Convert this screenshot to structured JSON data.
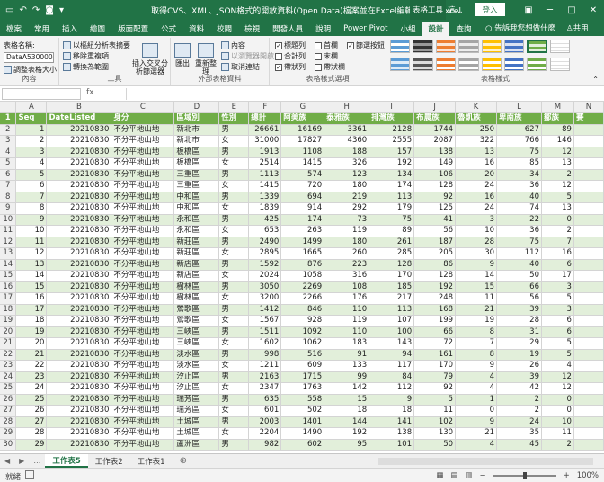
{
  "titlebar": {
    "title": "取得CVS、XML、JSON格式的開放資料(Open Data)檔案並在Excel編輯.xlsx - Excel",
    "context_tab": "表格工具",
    "search_label": "這...",
    "login": "登入"
  },
  "tabs": [
    "檔案",
    "常用",
    "插入",
    "繪圖",
    "版面配置",
    "公式",
    "資料",
    "校閱",
    "檢視",
    "開發人員",
    "說明",
    "Power Pivot",
    "小組",
    "設計",
    "查詢"
  ],
  "active_tab": "設計",
  "tell_me": "告訴我您想做什麼",
  "share": "共用",
  "ribbon": {
    "props": {
      "label": "表格名稱:",
      "value": "DataA53000000",
      "resize": "調整表格大小",
      "group": "內容"
    },
    "tools": {
      "pivot": "以樞紐分析表摘要",
      "remove_dup": "移除重複項",
      "convert": "轉換為範圍",
      "slicer": "插入交叉分析篩選器",
      "group": "工具"
    },
    "external": {
      "export": "匯出",
      "refresh": "重新整理",
      "props": "內容",
      "open_browser": "以瀏覽器開啟",
      "unlink": "取消連結",
      "group": "外部表格資料"
    },
    "options": {
      "header_row": "標題列",
      "total_row": "合計列",
      "banded_rows": "帶狀列",
      "first_col": "首欄",
      "last_col": "末欄",
      "banded_cols": "帶狀欄",
      "filter_btn": "篩選按鈕",
      "group": "表格樣式選項"
    },
    "styles": {
      "group": "表格樣式"
    }
  },
  "formula_bar": {
    "fx": "fx"
  },
  "columns": [
    "A",
    "B",
    "C",
    "D",
    "E",
    "F",
    "G",
    "H",
    "I",
    "J",
    "K",
    "L",
    "M",
    "N"
  ],
  "headers": [
    "Seq",
    "DateListed",
    "身分",
    "區域別",
    "性別",
    "總計",
    "阿美族",
    "泰雅族",
    "排灣族",
    "布農族",
    "魯凱族",
    "卑南族",
    "鄒族",
    "賽"
  ],
  "rows": [
    [
      "1",
      "20210830",
      "不分平地山地",
      "新北市",
      "男",
      "26661",
      "16169",
      "3361",
      "2128",
      "1744",
      "250",
      "627",
      "89",
      ""
    ],
    [
      "2",
      "20210830",
      "不分平地山地",
      "新北市",
      "女",
      "31000",
      "17827",
      "4360",
      "2555",
      "2087",
      "322",
      "766",
      "146",
      ""
    ],
    [
      "3",
      "20210830",
      "不分平地山地",
      "板橋區",
      "男",
      "1913",
      "1108",
      "188",
      "157",
      "138",
      "13",
      "75",
      "12",
      ""
    ],
    [
      "4",
      "20210830",
      "不分平地山地",
      "板橋區",
      "女",
      "2514",
      "1415",
      "326",
      "192",
      "149",
      "16",
      "85",
      "13",
      ""
    ],
    [
      "5",
      "20210830",
      "不分平地山地",
      "三重區",
      "男",
      "1113",
      "574",
      "123",
      "134",
      "106",
      "20",
      "34",
      "2",
      ""
    ],
    [
      "6",
      "20210830",
      "不分平地山地",
      "三重區",
      "女",
      "1415",
      "720",
      "180",
      "174",
      "128",
      "24",
      "36",
      "12",
      ""
    ],
    [
      "7",
      "20210830",
      "不分平地山地",
      "中和區",
      "男",
      "1339",
      "694",
      "219",
      "113",
      "92",
      "16",
      "40",
      "5",
      ""
    ],
    [
      "8",
      "20210830",
      "不分平地山地",
      "中和區",
      "女",
      "1839",
      "914",
      "292",
      "179",
      "125",
      "24",
      "74",
      "13",
      ""
    ],
    [
      "9",
      "20210830",
      "不分平地山地",
      "永和區",
      "男",
      "425",
      "174",
      "73",
      "75",
      "41",
      "3",
      "22",
      "0",
      ""
    ],
    [
      "10",
      "20210830",
      "不分平地山地",
      "永和區",
      "女",
      "653",
      "263",
      "119",
      "89",
      "56",
      "10",
      "36",
      "2",
      ""
    ],
    [
      "11",
      "20210830",
      "不分平地山地",
      "新莊區",
      "男",
      "2490",
      "1499",
      "180",
      "261",
      "187",
      "28",
      "75",
      "7",
      ""
    ],
    [
      "12",
      "20210830",
      "不分平地山地",
      "新莊區",
      "女",
      "2895",
      "1665",
      "260",
      "285",
      "205",
      "30",
      "112",
      "16",
      ""
    ],
    [
      "13",
      "20210830",
      "不分平地山地",
      "新店區",
      "男",
      "1592",
      "876",
      "223",
      "128",
      "86",
      "9",
      "40",
      "6",
      ""
    ],
    [
      "14",
      "20210830",
      "不分平地山地",
      "新店區",
      "女",
      "2024",
      "1058",
      "316",
      "170",
      "128",
      "14",
      "50",
      "17",
      ""
    ],
    [
      "15",
      "20210830",
      "不分平地山地",
      "樹林區",
      "男",
      "3050",
      "2269",
      "108",
      "185",
      "192",
      "15",
      "66",
      "3",
      ""
    ],
    [
      "16",
      "20210830",
      "不分平地山地",
      "樹林區",
      "女",
      "3200",
      "2266",
      "176",
      "217",
      "248",
      "11",
      "56",
      "5",
      ""
    ],
    [
      "17",
      "20210830",
      "不分平地山地",
      "鶯歌區",
      "男",
      "1412",
      "846",
      "110",
      "113",
      "168",
      "21",
      "39",
      "3",
      ""
    ],
    [
      "18",
      "20210830",
      "不分平地山地",
      "鶯歌區",
      "女",
      "1567",
      "928",
      "119",
      "107",
      "199",
      "19",
      "28",
      "6",
      ""
    ],
    [
      "19",
      "20210830",
      "不分平地山地",
      "三峽區",
      "男",
      "1511",
      "1092",
      "110",
      "100",
      "66",
      "8",
      "31",
      "6",
      ""
    ],
    [
      "20",
      "20210830",
      "不分平地山地",
      "三峽區",
      "女",
      "1602",
      "1062",
      "183",
      "143",
      "72",
      "7",
      "29",
      "5",
      ""
    ],
    [
      "21",
      "20210830",
      "不分平地山地",
      "淡水區",
      "男",
      "998",
      "516",
      "91",
      "94",
      "161",
      "8",
      "19",
      "5",
      ""
    ],
    [
      "22",
      "20210830",
      "不分平地山地",
      "淡水區",
      "女",
      "1211",
      "609",
      "133",
      "117",
      "170",
      "9",
      "26",
      "4",
      ""
    ],
    [
      "23",
      "20210830",
      "不分平地山地",
      "汐止區",
      "男",
      "2163",
      "1715",
      "99",
      "84",
      "79",
      "4",
      "39",
      "12",
      ""
    ],
    [
      "24",
      "20210830",
      "不分平地山地",
      "汐止區",
      "女",
      "2347",
      "1763",
      "142",
      "112",
      "92",
      "4",
      "42",
      "12",
      ""
    ],
    [
      "25",
      "20210830",
      "不分平地山地",
      "瑞芳區",
      "男",
      "635",
      "558",
      "15",
      "9",
      "5",
      "1",
      "2",
      "0",
      ""
    ],
    [
      "26",
      "20210830",
      "不分平地山地",
      "瑞芳區",
      "女",
      "601",
      "502",
      "18",
      "18",
      "11",
      "0",
      "2",
      "0",
      ""
    ],
    [
      "27",
      "20210830",
      "不分平地山地",
      "土城區",
      "男",
      "2003",
      "1401",
      "144",
      "141",
      "102",
      "9",
      "24",
      "10",
      ""
    ],
    [
      "28",
      "20210830",
      "不分平地山地",
      "土城區",
      "女",
      "2204",
      "1490",
      "192",
      "138",
      "130",
      "21",
      "35",
      "11",
      ""
    ],
    [
      "29",
      "20210830",
      "不分平地山地",
      "蘆洲區",
      "男",
      "982",
      "602",
      "95",
      "101",
      "50",
      "4",
      "45",
      "2",
      ""
    ]
  ],
  "sheet_tabs": [
    "工作表5",
    "工作表2",
    "工作表1"
  ],
  "active_sheet": "工作表5",
  "status": {
    "ready": "就緒",
    "zoom": "100%"
  }
}
